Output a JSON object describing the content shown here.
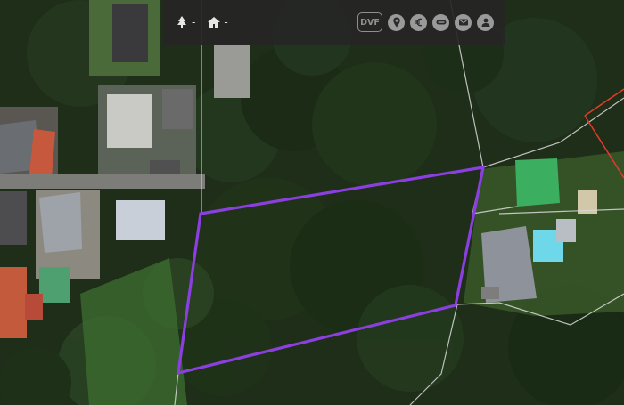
{
  "toolbar": {
    "trees_value": "-",
    "houses_value": "-",
    "dvf_label": "DVF",
    "buttons": [
      "location-pin",
      "euro",
      "road-sign",
      "mail",
      "user"
    ]
  },
  "map": {
    "type": "satellite",
    "parcel_outline_color": "#8b3fe0",
    "cadastre_line_color": "#d9d9d9",
    "neighbor_parcel_color": "#e03a2a"
  }
}
